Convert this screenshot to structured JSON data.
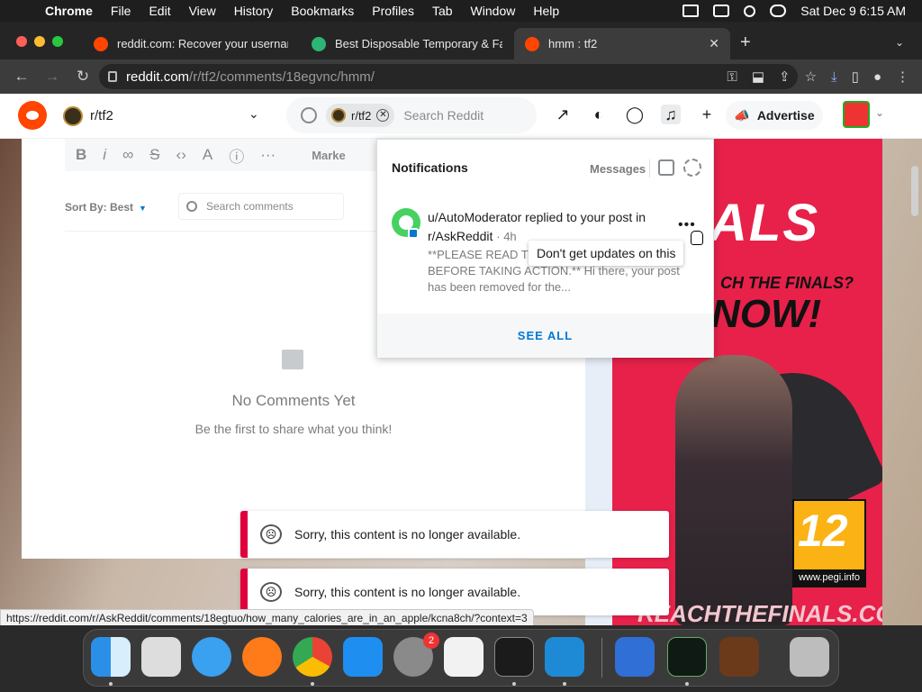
{
  "menubar": {
    "app": "Chrome",
    "items": [
      "File",
      "Edit",
      "View",
      "History",
      "Bookmarks",
      "Profiles",
      "Tab",
      "Window",
      "Help"
    ],
    "datetime": "Sat Dec 9  6:15 AM"
  },
  "tabs": [
    {
      "title": "reddit.com: Recover your username",
      "active": false
    },
    {
      "title": "Best Disposable Temporary & Fake",
      "active": false
    },
    {
      "title": "hmm : tf2",
      "active": true
    }
  ],
  "address": {
    "domain": "reddit.com",
    "path": "/r/tf2/comments/18egvnc/hmm/"
  },
  "reddit_header": {
    "subreddit": "r/tf2",
    "search_chip": "r/tf2",
    "search_placeholder": "Search Reddit",
    "advertise": "Advertise"
  },
  "editor": {
    "markdown_label": "Marke"
  },
  "comments": {
    "sort_label": "Sort By: Best",
    "search_placeholder": "Search comments",
    "empty_title": "No Comments Yet",
    "empty_sub": "Be the first to share what you think!"
  },
  "notifications": {
    "title": "Notifications",
    "messages_label": "Messages",
    "item": {
      "text": "u/AutoModerator replied to your post in r/AskReddit",
      "time": "· 4h",
      "body": "**PLEASE READ THIS IN ITS ENTIRETY BEFORE TAKING ACTION.** Hi there, your post has been removed for the...",
      "tooltip": "Don't get updates on this"
    },
    "see_all": "SEE ALL"
  },
  "ad": {
    "headline": "ALS",
    "tag1": "CH THE FINALS?",
    "tag2": "NOW!",
    "pegi_number": "12",
    "pegi_url": "www.pegi.info",
    "site": "REACHTHEFINALS.COM"
  },
  "toasts": [
    "Sorry, this content is no longer available.",
    "Sorry, this content is no longer available."
  ],
  "status_url": "https://reddit.com/r/AskReddit/comments/18egtuo/how_many_calories_are_in_an_apple/kcna8ch/?context=3",
  "dock": {
    "settings_badge": "2",
    "apps": [
      "finder-icon",
      "launchpad-icon",
      "safari-icon",
      "firefox-icon",
      "chrome-icon",
      "app-store-icon",
      "system-settings-icon",
      "textedit-icon",
      "terminal-icon",
      "vscode-icon",
      "remote-desktop-icon",
      "activity-monitor-icon",
      "garageband-icon",
      "trash-icon"
    ]
  },
  "colors": {
    "reddit_orange": "#ff4500",
    "link_blue": "#0079d3",
    "toast_red": "#e0003c",
    "ad_red": "#e7214a"
  }
}
